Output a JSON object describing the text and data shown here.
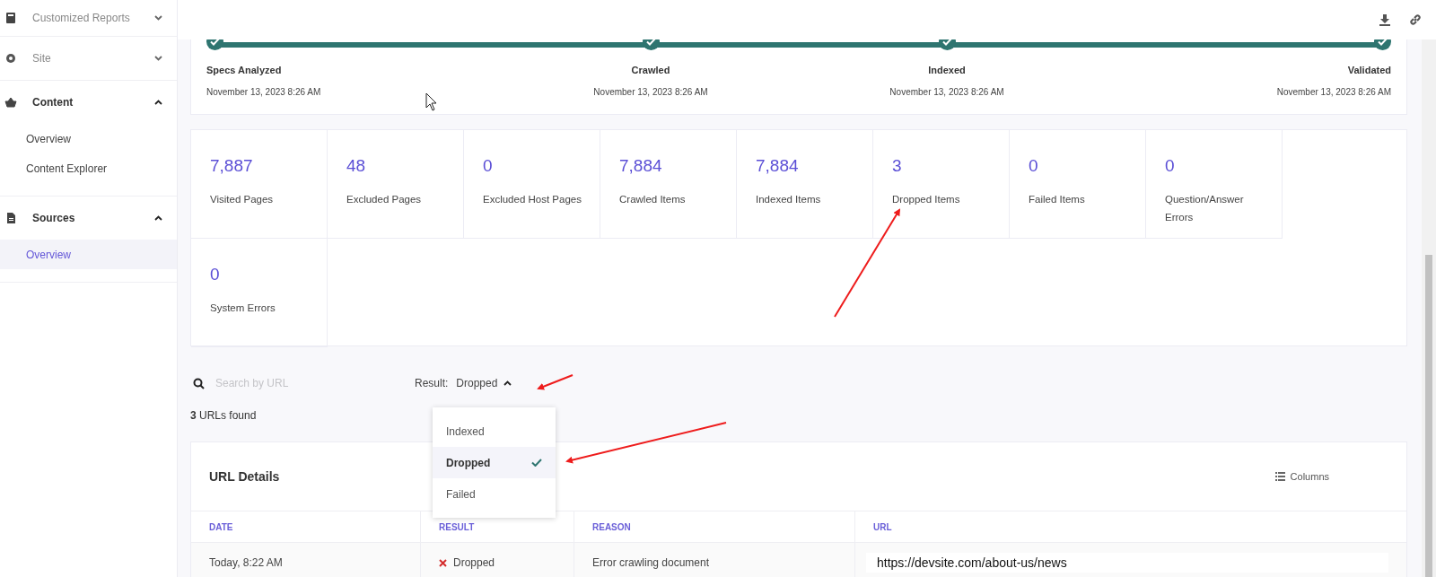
{
  "sidebar": {
    "items": [
      {
        "label": "Customized Reports",
        "expanded": false
      },
      {
        "label": "Site",
        "expanded": false
      },
      {
        "label": "Content",
        "expanded": true,
        "children": [
          {
            "label": "Overview",
            "selected": false
          },
          {
            "label": "Content Explorer",
            "selected": false
          }
        ]
      },
      {
        "label": "Sources",
        "expanded": true,
        "children": [
          {
            "label": "Overview",
            "selected": true
          }
        ]
      }
    ]
  },
  "timeline": {
    "steps": [
      {
        "label": "Specs Analyzed",
        "date": "November 13, 2023 8:26 AM",
        "completed": true
      },
      {
        "label": "Crawled",
        "date": "November 13, 2023 8:26 AM",
        "completed": true
      },
      {
        "label": "Indexed",
        "date": "November 13, 2023 8:26 AM",
        "completed": true
      },
      {
        "label": "Validated",
        "date": "November 13, 2023 8:26 AM",
        "completed": true
      }
    ]
  },
  "stats": [
    {
      "value": "7,887",
      "label": "Visited Pages"
    },
    {
      "value": "48",
      "label": "Excluded Pages"
    },
    {
      "value": "0",
      "label": "Excluded Host Pages"
    },
    {
      "value": "7,884",
      "label": "Crawled Items"
    },
    {
      "value": "7,884",
      "label": "Indexed Items"
    },
    {
      "value": "3",
      "label": "Dropped Items"
    },
    {
      "value": "0",
      "label": "Failed Items"
    },
    {
      "value": "0",
      "label": "Question/Answer Errors"
    },
    {
      "value": "0",
      "label": "System Errors"
    }
  ],
  "search": {
    "placeholder": "Search by URL"
  },
  "result_filter": {
    "label": "Result:",
    "value": "Dropped",
    "expanded": true,
    "options": [
      {
        "label": "Indexed",
        "selected": false
      },
      {
        "label": "Dropped",
        "selected": true
      },
      {
        "label": "Failed",
        "selected": false
      }
    ]
  },
  "found": {
    "count": "3",
    "text": "URLs found"
  },
  "table": {
    "title": "URL Details",
    "columns_button": "Columns",
    "columns": [
      "DATE",
      "RESULT",
      "REASON",
      "URL"
    ],
    "rows": [
      {
        "date": "Today, 8:22 AM",
        "result": "Dropped",
        "reason": "Error crawling document",
        "url": "https://devsite.com/about-us/news"
      }
    ]
  }
}
